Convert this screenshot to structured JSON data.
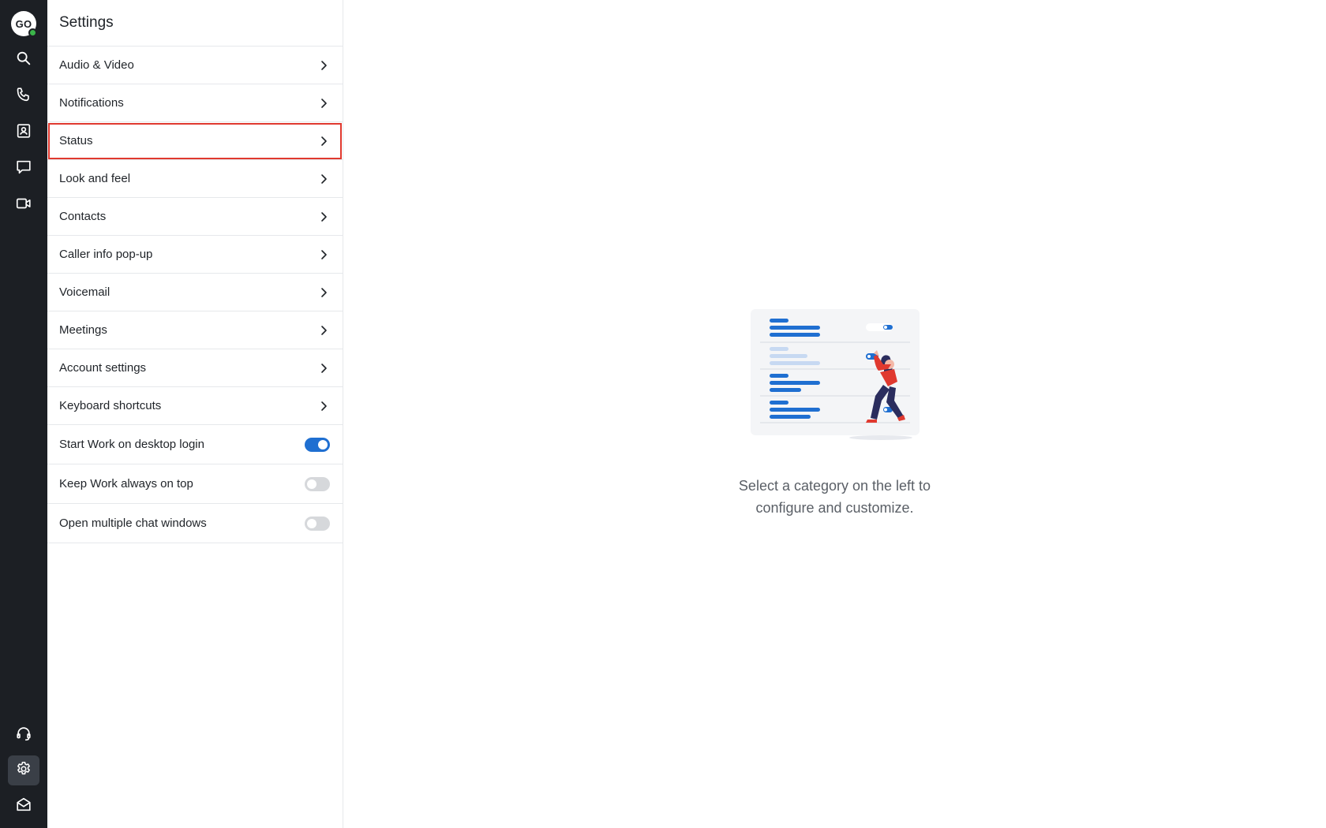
{
  "user": {
    "initials": "GO",
    "presence": "available"
  },
  "rail": {
    "top": [
      {
        "name": "search-icon"
      },
      {
        "name": "phone-icon"
      },
      {
        "name": "contacts-icon"
      },
      {
        "name": "chat-icon"
      },
      {
        "name": "video-icon"
      }
    ],
    "bottom": [
      {
        "name": "headset-icon"
      },
      {
        "name": "gear-icon",
        "active": true
      },
      {
        "name": "mail-icon"
      }
    ]
  },
  "settings": {
    "title": "Settings",
    "items": [
      {
        "label": "Audio & Video"
      },
      {
        "label": "Notifications"
      },
      {
        "label": "Status",
        "highlighted": true
      },
      {
        "label": "Look and feel"
      },
      {
        "label": "Contacts"
      },
      {
        "label": "Caller info pop-up"
      },
      {
        "label": "Voicemail"
      },
      {
        "label": "Meetings"
      },
      {
        "label": "Account settings"
      },
      {
        "label": "Keyboard shortcuts"
      }
    ],
    "toggles": [
      {
        "label": "Start Work on desktop login",
        "on": true
      },
      {
        "label": "Keep Work always on top",
        "on": false
      },
      {
        "label": "Open multiple chat windows",
        "on": false
      }
    ]
  },
  "empty_state": {
    "line1": "Select a category on the left to",
    "line2": "configure and customize."
  },
  "colors": {
    "rail_bg": "#1c1f24",
    "accent": "#1f6fd1",
    "highlight_border": "#e0392f",
    "presence": "#3bb54a"
  }
}
